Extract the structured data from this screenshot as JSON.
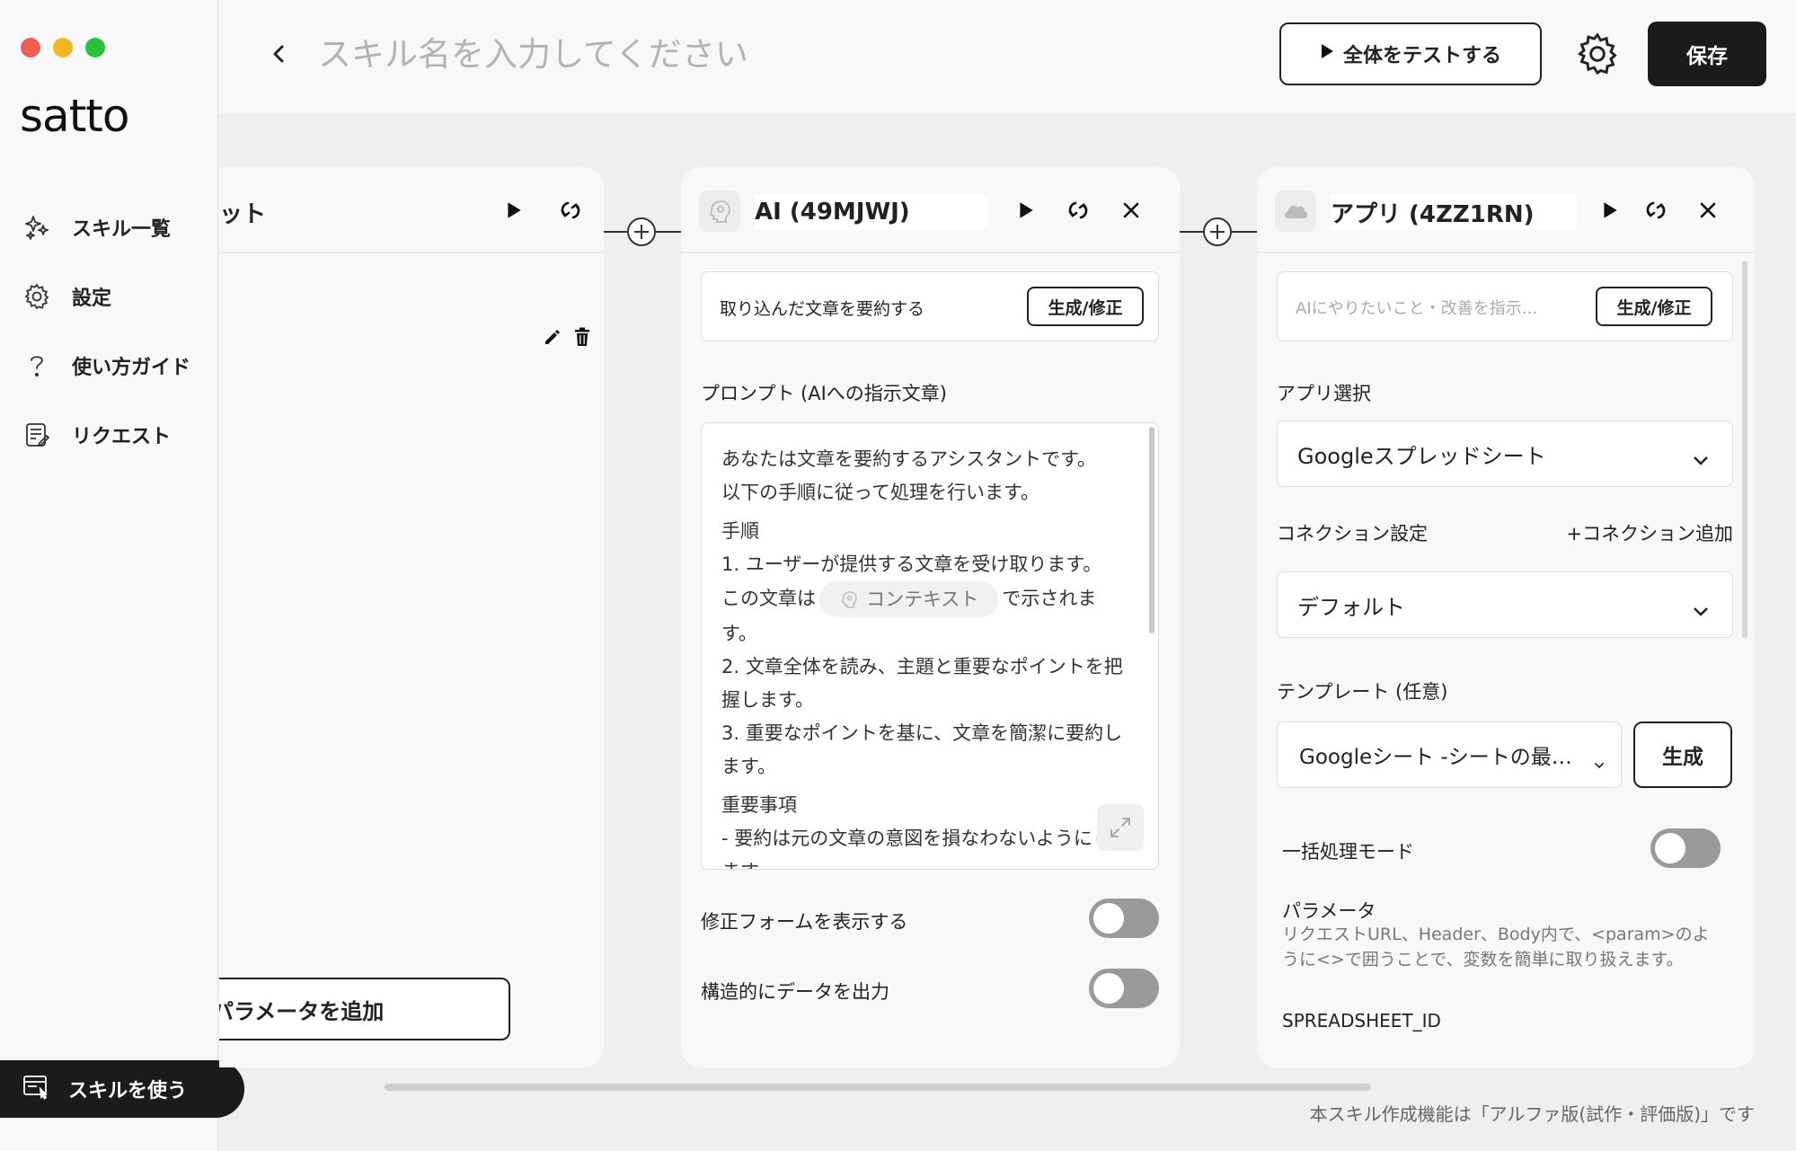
{
  "window": {
    "traffic_lights": [
      "#ee5e56",
      "#f4b528",
      "#29c23f"
    ]
  },
  "sidebar": {
    "logo": "satto",
    "items": [
      {
        "label": "スキル一覧",
        "icon": "sparkles-icon"
      },
      {
        "label": "設定",
        "icon": "gear-icon"
      },
      {
        "label": "使い方ガイド",
        "icon": "question-icon"
      },
      {
        "label": "リクエスト",
        "icon": "request-doc-icon"
      }
    ],
    "use_skill_label": "スキルを使う"
  },
  "header": {
    "skill_name_placeholder": "スキル名を入力してください",
    "test_all_label": "全体をテストする",
    "save_label": "保存"
  },
  "cards": {
    "left": {
      "title_partial": "ット",
      "add_param_label": "パラメータを追加"
    },
    "ai": {
      "title": "AI (49MJWJ)",
      "instruction_value": "取り込んだ文章を要約する",
      "generate_label": "生成/修正",
      "prompt_label": "プロンプト (AIへの指示文章)",
      "prompt_lines": [
        "あなたは文章を要約するアシスタントです。",
        "以下の手順に従って処理を行います。",
        "手順",
        "1. ユーザーが提供する文章を受け取ります。",
        "この文章は",
        "コンテキスト",
        "で示されます。",
        "2. 文章全体を読み、主題と重要なポイントを把握します。",
        "3. 重要なポイントを基に、文章を簡潔に要約します。",
        "重要事項",
        "- 要約は元の文章の意図を損なわないようにします。"
      ],
      "show_fix_form_label": "修正フォームを表示する",
      "show_fix_form_on": false,
      "structured_output_label": "構造的にデータを出力",
      "structured_output_on": false
    },
    "app": {
      "title": "アプリ (4ZZ1RN)",
      "instruction_placeholder": "AIにやりたいこと・改善を指示…",
      "generate_label": "生成/修正",
      "app_select_label": "アプリ選択",
      "app_selected": "Googleスプレッドシート",
      "connection_label": "コネクション設定",
      "add_connection_label": "+コネクション追加",
      "connection_selected": "デフォルト",
      "template_label": "テンプレート (任意)",
      "template_selected": "Googleシート -シートの最…",
      "template_generate_label": "生成",
      "batch_mode_label": "一括処理モード",
      "batch_mode_on": false,
      "params_label": "パラメータ",
      "params_desc_1": "リクエストURL、Header、Body内で、<param>のよ",
      "params_desc_2": "うに<>で囲うことで、変数を簡単に取り扱えます。",
      "param_name": "SPREADSHEET_ID"
    }
  },
  "footer_note": "本スキル作成機能は「アルファ版(試作・評価版)」です"
}
